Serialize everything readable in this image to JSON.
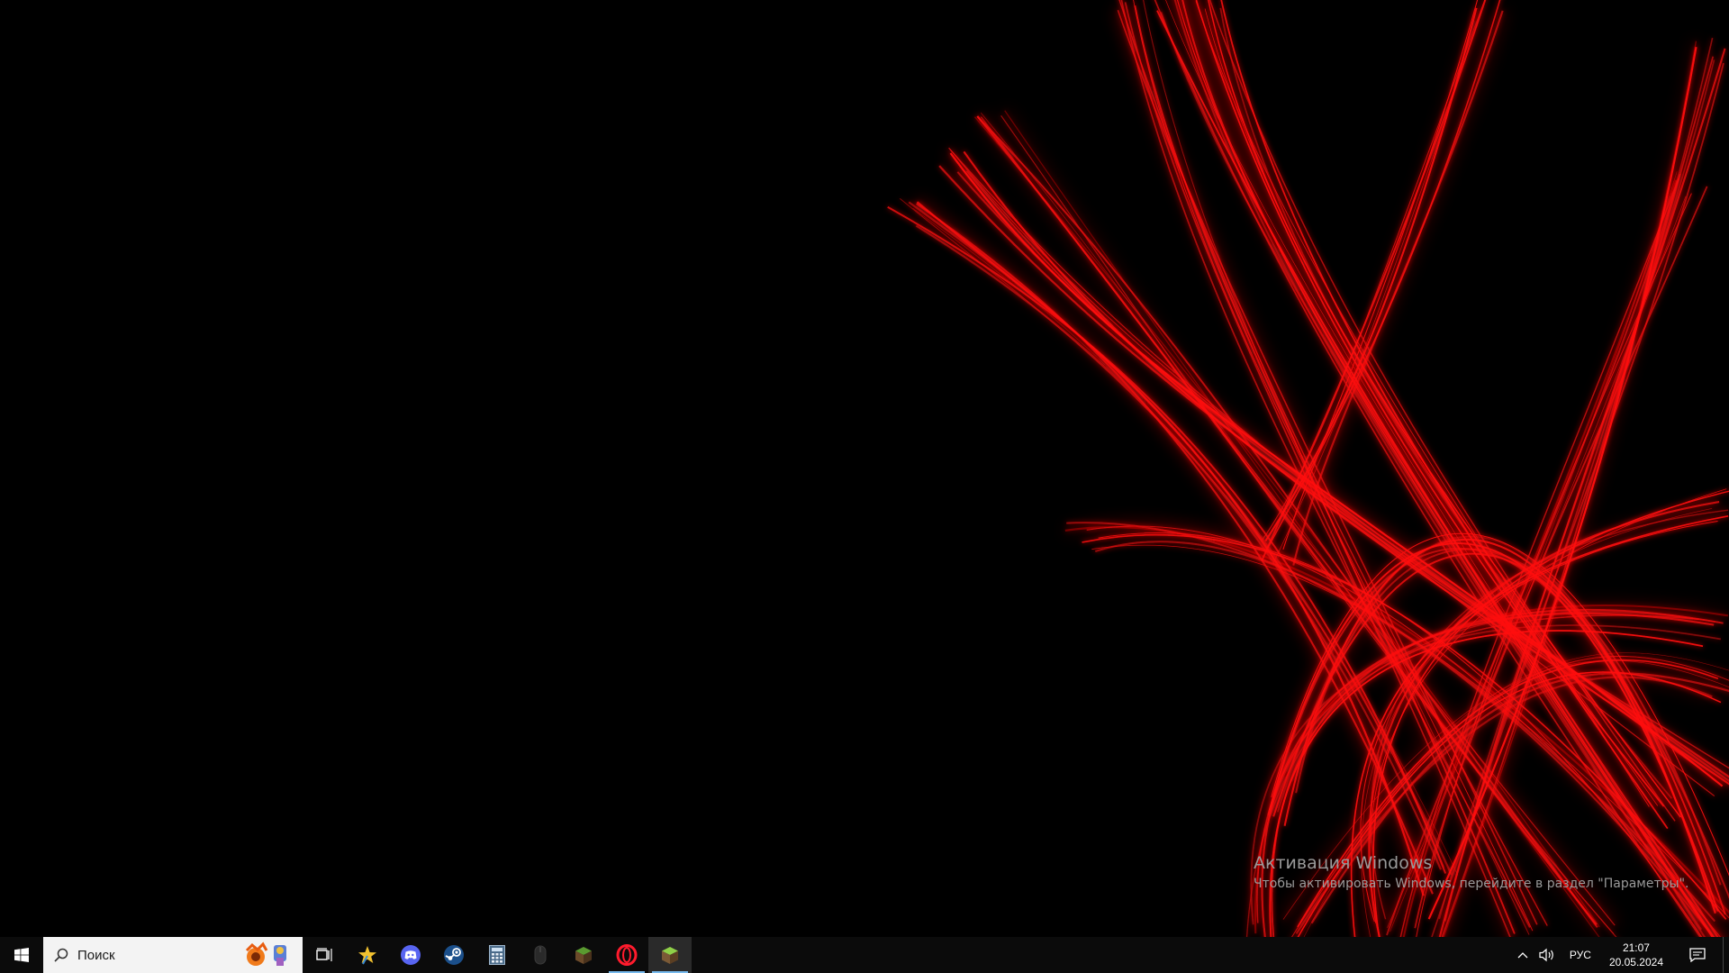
{
  "desktop": {
    "wallpaper": "red-abstract-lines",
    "accent_color": "#ff0000",
    "activation": {
      "title": "Активация Windows",
      "subtitle": "Чтобы активировать Windows, перейдите в раздел \"Параметры\"."
    }
  },
  "taskbar": {
    "start_icon": "windows-logo-icon",
    "search": {
      "placeholder": "Поиск",
      "icon": "search-icon"
    },
    "pinned": [
      {
        "name": "task-view",
        "icon": "task-view-icon"
      },
      {
        "name": "app-star",
        "icon": "star-icon"
      },
      {
        "name": "discord",
        "icon": "discord-icon"
      },
      {
        "name": "steam",
        "icon": "steam-icon"
      },
      {
        "name": "calculator",
        "icon": "calculator-icon"
      },
      {
        "name": "mouse-app",
        "icon": "mouse-icon"
      },
      {
        "name": "minecraft-launcher",
        "icon": "minecraft-icon"
      },
      {
        "name": "opera",
        "icon": "opera-icon"
      },
      {
        "name": "minecraft",
        "icon": "minecraft-icon",
        "active": true
      }
    ],
    "tray": {
      "language": "РУС",
      "time": "21:07",
      "date": "20.05.2024"
    }
  }
}
